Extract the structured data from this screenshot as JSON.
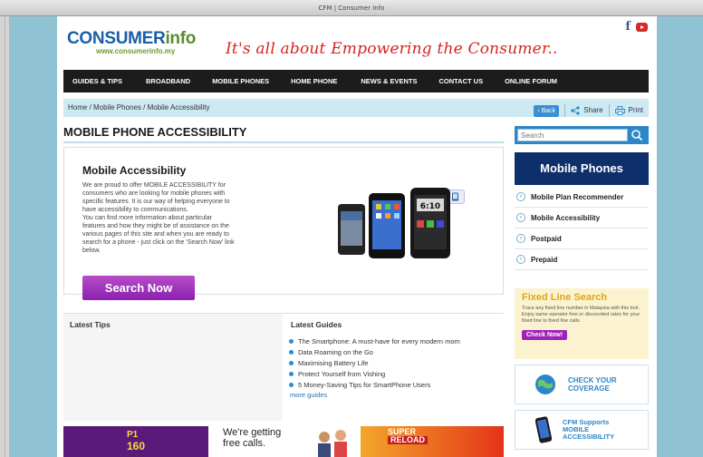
{
  "window": {
    "title": "CFM | Consumer Info"
  },
  "header": {
    "brand_main": "CONSUMER",
    "brand_suffix": "info",
    "brand_url": "www.consumerinfo.my",
    "tagline": "It's all about Empowering the Consumer..",
    "social": {
      "facebook": "f",
      "youtube_icon": "youtube-icon"
    }
  },
  "nav": {
    "items": [
      "GUIDES & TIPS",
      "BROADBAND",
      "MOBILE PHONES",
      "HOME PHONE",
      "NEWS & EVENTS",
      "CONTACT US",
      "ONLINE FORUM"
    ]
  },
  "breadcrumb": {
    "text": "Home / Mobile Phones / Mobile Accessibility",
    "back": "Back",
    "share": "Share",
    "print": "Print"
  },
  "main": {
    "heading": "MOBILE PHONE ACCESSIBILITY",
    "hero": {
      "title": "Mobile Accessibility",
      "body_lines": [
        "We are proud to offer MOBILE ACCESSIBILITY for",
        "consumers who are looking for mobile phones with",
        "specific features. It is our way of helping everyone to",
        "have accessibility to communications.",
        "You can find more information about particular",
        "features and how they might be of assistance on the",
        "various pages of this site and when you are ready to",
        "search for a phone - just click on the 'Search Now' link",
        "below."
      ],
      "button": "Search Now"
    },
    "latest_tips": {
      "title": "Latest Tips"
    },
    "latest_guides": {
      "title": "Latest Guides",
      "items": [
        "The Smartphone: A must-have for every modern mom",
        "Data Roaming on the Go",
        "Maximising Battery Life",
        "Protect Yourself from Vishing",
        "5 Money-Saving Tips for SmartPhone Users"
      ],
      "more": "more guides"
    },
    "ads": {
      "ad1_text": "P1",
      "ad1_sub": "160",
      "ad2_line1": "We're getting",
      "ad2_line2": "free calls.",
      "ad3_line1": "SUPER",
      "ad3_line2": "RELOAD"
    }
  },
  "sidebar": {
    "search_placeholder": "Search",
    "mobile_heading": "Mobile Phones",
    "links": [
      "Mobile Plan Recommender",
      "Mobile Accessibility",
      "Postpaid",
      "Prepaid"
    ],
    "fixed_line": {
      "title": "Fixed Line Search",
      "desc": "Trace any fixed line number in Malaysia with this tool. Enjoy same operator free or discounted rates for your fixed line to fixed line calls.",
      "button": "Check Now!"
    },
    "coverage": {
      "line1": "CHECK YOUR",
      "line2": "COVERAGE"
    },
    "cfm": {
      "line1": "CFM Supports",
      "line2": "MOBILE",
      "line3": "ACCESSIBILITY"
    }
  },
  "colors": {
    "nav_bg": "#1c1c1c",
    "accent_blue": "#2b87c8",
    "brand_red": "#d8231f",
    "cta_purple": "#8b1fb0",
    "sidebar_navy": "#0f2f6b"
  }
}
